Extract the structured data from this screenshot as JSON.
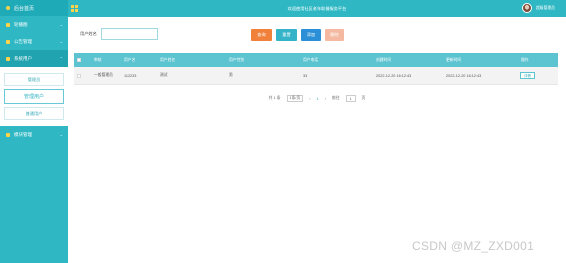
{
  "sidebar": {
    "brand": "后台首页",
    "items": [
      {
        "label": "轮播图",
        "chevron": "⌄"
      },
      {
        "label": "公告管理",
        "chevron": "⌄"
      },
      {
        "label": "系统用户",
        "chevron": "⌃"
      }
    ],
    "submenu": [
      "管理员",
      "管理用户",
      "普通用户"
    ],
    "bottom_item": {
      "label": "模块管理",
      "chevron": "⌄"
    }
  },
  "topbar": {
    "title": "欢迎使用社区老年助餐服务平台",
    "user": "超级管理员"
  },
  "search": {
    "label": "用户姓名",
    "value": "",
    "placeholder": ""
  },
  "buttons": {
    "search": "查询",
    "reset": "重置",
    "add": "添加",
    "delete": "删除"
  },
  "table": {
    "columns": [
      "审核",
      "用户名",
      "用户姓名",
      "用户性别",
      "用户电话",
      "创建时间",
      "更新时间",
      "操作"
    ],
    "rows": [
      {
        "status": "一般管理员",
        "username": "112233",
        "name": "测试",
        "gender": "男",
        "phone": "33",
        "created": "2022-12-20 16:12:43",
        "updated": "2022-12-20 16:12:43",
        "action": "详情"
      }
    ]
  },
  "pager": {
    "total": "共 1 条",
    "page_size": "1条/页",
    "prev": "‹",
    "page": "1",
    "next": "›",
    "goto_label": "前往",
    "goto_value": "1",
    "goto_unit": "页"
  },
  "watermark": "CSDN @MZ_ZXD001"
}
